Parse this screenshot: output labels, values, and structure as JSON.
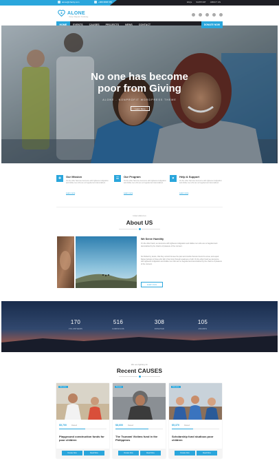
{
  "topbar": {
    "email": "alone@charity.com",
    "phone": "+888 8888 555",
    "links": [
      "FAQs",
      "SUPPORT",
      "ABOUT US"
    ]
  },
  "brand": {
    "name": "ALONE",
    "tagline": "Charity / Nonprofit / Fundraising"
  },
  "nav": {
    "items": [
      {
        "label": "HOME",
        "active": true
      },
      {
        "label": "EVENTS",
        "active": false
      },
      {
        "label": "CAUSES",
        "active": false
      },
      {
        "label": "PROJECTS",
        "active": false
      },
      {
        "label": "NEWS",
        "active": false
      },
      {
        "label": "CONTACT",
        "active": false
      }
    ],
    "donate_label": "DONATE NOW"
  },
  "hero": {
    "title_line1": "No one has become",
    "title_line2": "poor from Giving",
    "subtitle": "ALONE - NONPROFIT WORDPRESS THEME",
    "button": "Learn More"
  },
  "missions": [
    {
      "icon": "mission-icon",
      "title": "Our Mission",
      "text": "On the other hand we denounce with righteous indignation and dislike men who are so beguiled and demoralized.",
      "link": "Learn more"
    },
    {
      "icon": "program-icon",
      "title": "Our Program",
      "text": "On the other hand we denounce with righteous indignation and dislike men who are so beguiled and demoralized.",
      "link": "Learn more"
    },
    {
      "icon": "support-icon",
      "title": "Help & Support",
      "text": "On the other hand we denounce with righteous indignation and dislike men who are so beguiled and demoralized.",
      "link": "Learn more"
    }
  ],
  "about": {
    "kicker": "know about us",
    "title": "About US",
    "heading": "We Serve Humility",
    "p1": "On the other hand, we denounce with righteous indignation and dislike men who are so beguiled and demoralized by the charms of pleasure of the moment.",
    "p2": "So blinded by desire, that they cannot foresee the pain and trouble that are bound to ensue; and equal blame belongs to those who fail in their duty through weakness of will. On the other hand we denounce with righteous indignation and dislike men who are so beguiled and demoralized by the charms of pleasure of the moment.",
    "button": "Learn more"
  },
  "stats": [
    {
      "value": "170",
      "label": "VOLUNTEERS"
    },
    {
      "value": "516",
      "label": "CAMPAIGNS"
    },
    {
      "value": "308",
      "label": "DONATED"
    },
    {
      "value": "105",
      "label": "AWARDS"
    }
  ],
  "causes": {
    "kicker": "We are fighting for",
    "title": "Recent CAUSES",
    "items": [
      {
        "tag": "Education",
        "raised": "$5,700",
        "goal": "Raised",
        "progress": 0.55,
        "title": "Playground construction funds for poor children",
        "btn1": "Donate Now",
        "btn2": "Read More"
      },
      {
        "tag": "Disaster",
        "raised": "$8,600",
        "goal": "Raised",
        "progress": 0.7,
        "title": "The Tsunami Victims fund in the Philippines",
        "btn1": "Donate Now",
        "btn2": "Read More"
      },
      {
        "tag": "Education",
        "raised": "$5,370",
        "goal": "Raised",
        "progress": 0.45,
        "title": "Scholarship fund studious poor children",
        "btn1": "Donate Now",
        "btn2": "Read More"
      }
    ]
  },
  "colors": {
    "accent": "#2aa6dc",
    "dark": "#1e1e24"
  }
}
